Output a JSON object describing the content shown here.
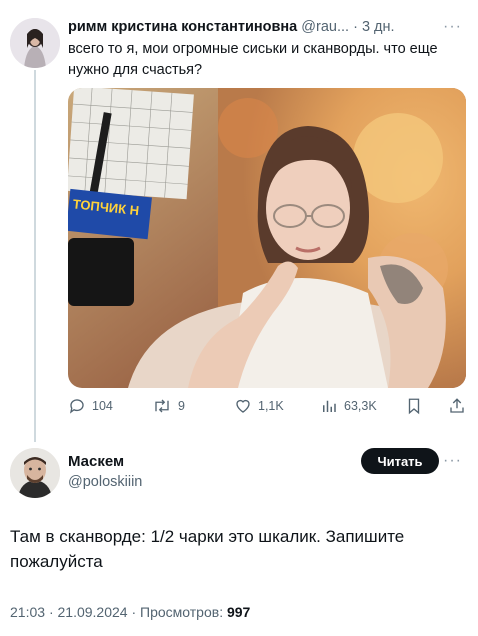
{
  "tweet": {
    "author_name": "римм кристина константиновна",
    "author_handle": "@rau...",
    "age": "3 дн.",
    "text": "всего то я, мои огромные сиськи и сканворды. что еще нужно для счастья?",
    "photo_book_cover_text": "ТОПЧИК Н",
    "stats": {
      "replies": "104",
      "retweets": "9",
      "likes": "1,1K",
      "views": "63,3K"
    }
  },
  "reply": {
    "author_name": "Маскем",
    "author_handle": "@poloskiiin",
    "follow_label": "Читать",
    "text": "Там в сканворде: 1/2 чарки это шкалик. Запишите пожалуйста",
    "time": "21:03",
    "date": "21.09.2024",
    "views_label": "Просмотров:",
    "views_count": "997"
  },
  "colors": {
    "text": "#0f1419",
    "secondary": "#536471",
    "thread_line": "#cfd9de",
    "button": "#0f1419"
  }
}
